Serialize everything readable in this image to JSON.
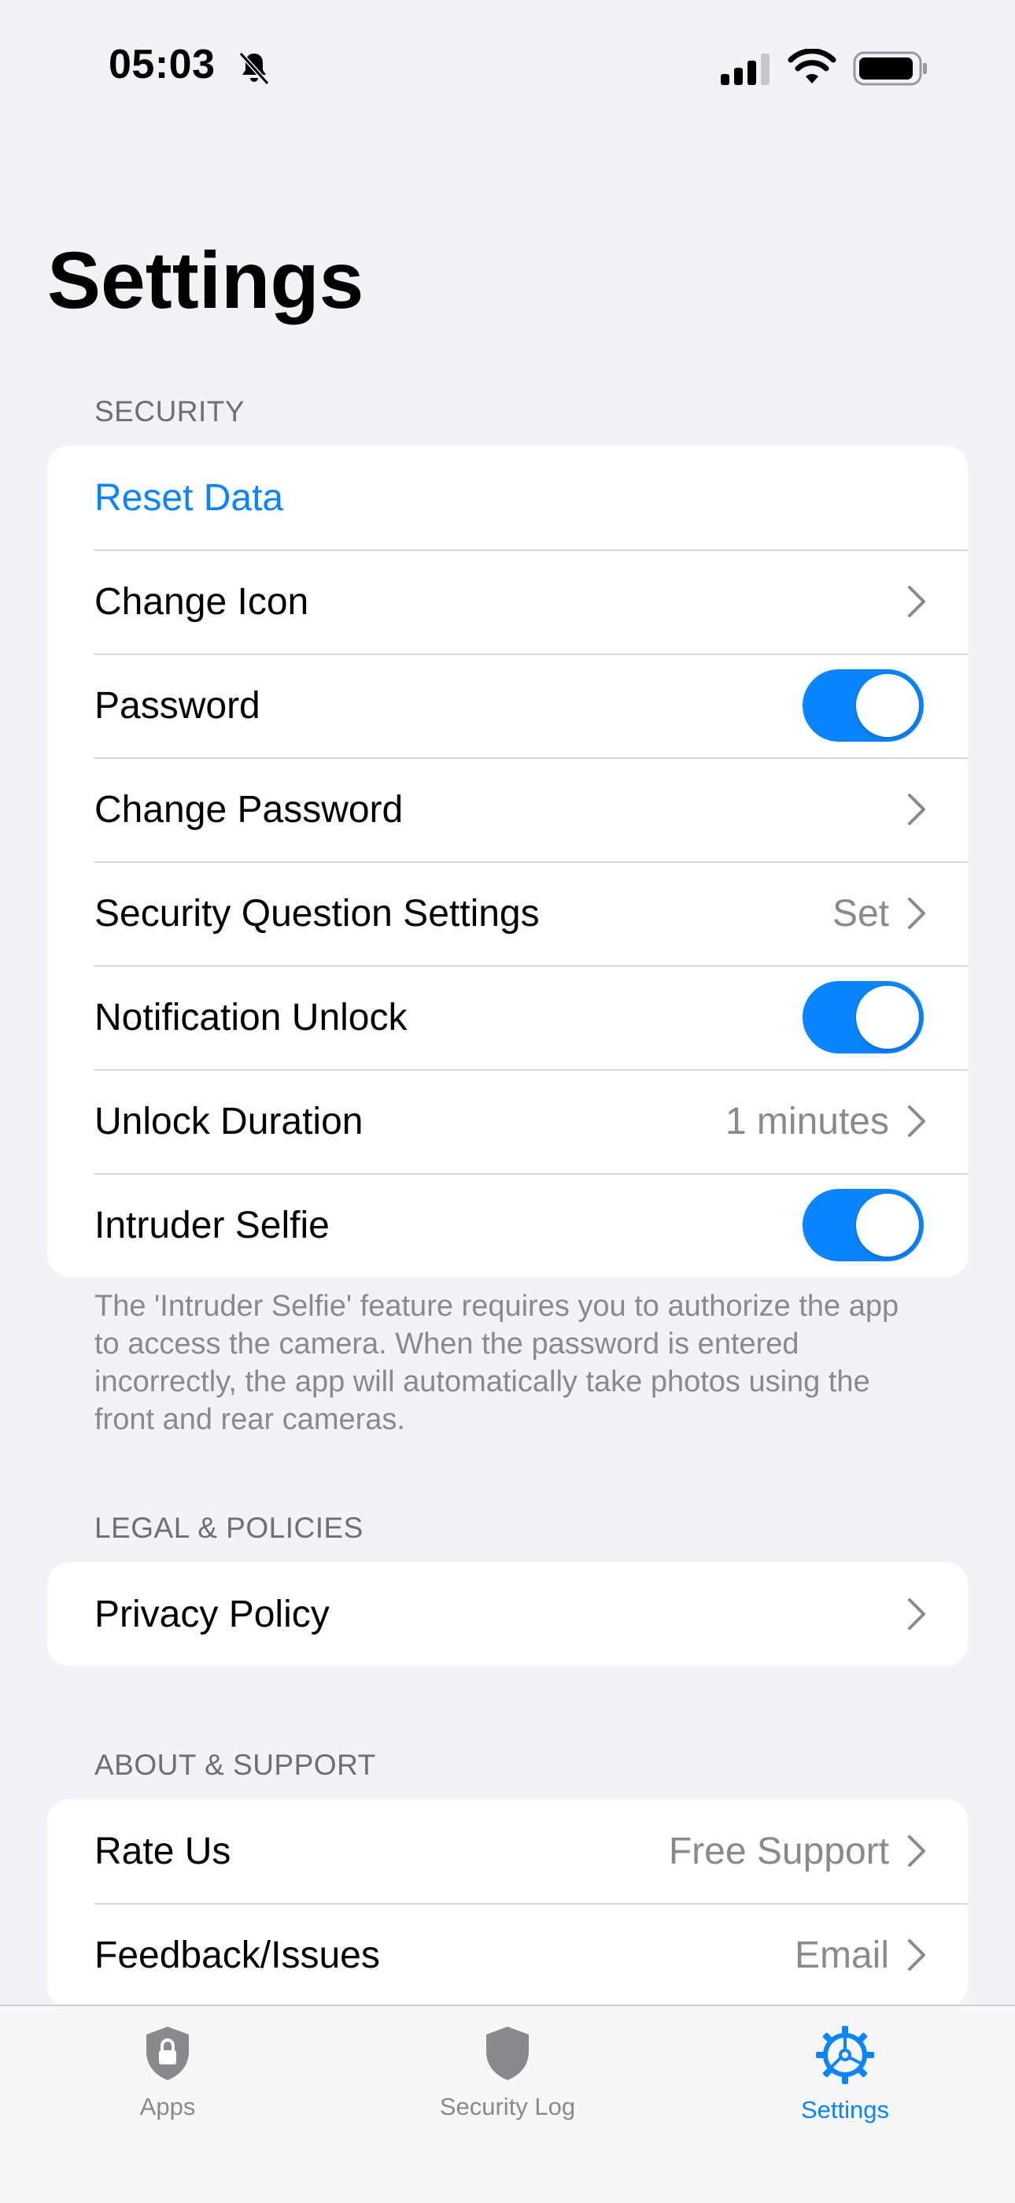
{
  "status_bar": {
    "time": "05:03"
  },
  "page": {
    "title": "Settings"
  },
  "sections": {
    "security": {
      "header": "SECURITY",
      "reset_data": "Reset Data",
      "change_icon": "Change Icon",
      "password": {
        "label": "Password",
        "on": true
      },
      "change_password": "Change Password",
      "security_question": {
        "label": "Security Question Settings",
        "value": "Set"
      },
      "notification_unlock": {
        "label": "Notification Unlock",
        "on": true
      },
      "unlock_duration": {
        "label": "Unlock Duration",
        "value": "1 minutes"
      },
      "intruder_selfie": {
        "label": "Intruder Selfie",
        "on": true
      },
      "footnote": "The 'Intruder Selfie' feature requires you to authorize the app to access the camera. When the password is entered incorrectly, the app will automatically take photos using the front and rear cameras."
    },
    "legal": {
      "header": "LEGAL & POLICIES",
      "privacy_policy": "Privacy Policy"
    },
    "about": {
      "header": "ABOUT & SUPPORT",
      "rate_us": {
        "label": "Rate Us",
        "value": "Free Support"
      },
      "feedback": {
        "label": "Feedback/Issues",
        "value": "Email"
      }
    }
  },
  "tab_bar": {
    "apps": "Apps",
    "security_log": "Security Log",
    "settings": "Settings",
    "active": "settings"
  },
  "colors": {
    "accent": "#0a84ff",
    "background": "#f2f2f7",
    "secondary_text": "#8a8a8e"
  }
}
